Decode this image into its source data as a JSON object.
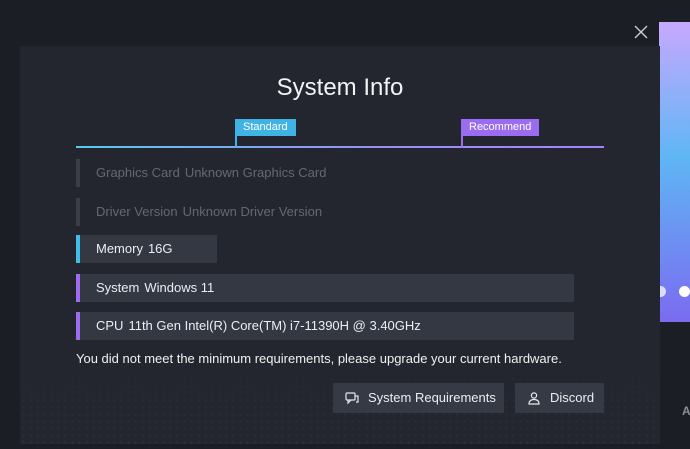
{
  "dialog": {
    "title": "System Info",
    "close_icon": "close-icon"
  },
  "scale": {
    "standard_label": "Standard",
    "recommend_label": "Recommend"
  },
  "specs": [
    {
      "label": "Graphics Card",
      "value": "Unknown Graphics Card",
      "status": "unknown"
    },
    {
      "label": "Driver Version",
      "value": "Unknown Driver Version",
      "status": "unknown"
    },
    {
      "label": "Memory",
      "value": "16G",
      "status": "standard"
    },
    {
      "label": "System",
      "value": "Windows 11",
      "status": "recommend"
    },
    {
      "label": "CPU",
      "value": "11th Gen Intel(R) Core(TM) i7-11390H @ 3.40GHz",
      "status": "recommend"
    }
  ],
  "message": "You did not meet the minimum requirements, please upgrade your current hardware.",
  "buttons": {
    "requirements_label": "System Requirements",
    "requirements_icon": "chat-icon",
    "discord_label": "Discord",
    "discord_icon": "user-icon"
  },
  "background": {
    "letter": "A"
  },
  "colors": {
    "standard": "#3fb4e4",
    "recommend": "#9b6cf2",
    "panel": "#23262e",
    "row": "#343842"
  }
}
